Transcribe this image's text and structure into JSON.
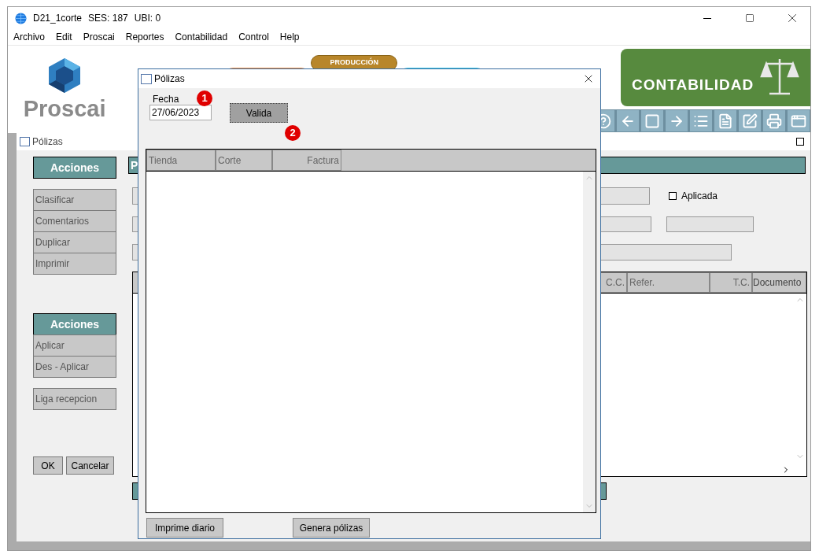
{
  "window": {
    "title": "D21_1corte",
    "session": "SES: 187",
    "location": "UBI: 0"
  },
  "menu": [
    "Archivo",
    "Edit",
    "Proscai",
    "Reportes",
    "Contabilidad",
    "Control",
    "Help"
  ],
  "banner": {
    "brand": "Proscai",
    "module_tab": "PRODUCCIÓN",
    "module": "CONTABILIDAD"
  },
  "child_window": {
    "title": "Pólizas"
  },
  "actions": [
    {
      "title": "Acciones",
      "items": [
        "Clasificar",
        "Comentarios",
        "Duplicar",
        "Imprimir"
      ]
    },
    {
      "title": "Acciones",
      "items": [
        "Aplicar",
        "Des - Aplicar"
      ]
    },
    {
      "items": [
        "Liga recepcion"
      ]
    }
  ],
  "form": {
    "header": "P",
    "applied": {
      "label": "Aplicada",
      "checked": false
    },
    "columns": [
      "C.C.",
      "Refer.",
      "T.C.",
      "Documento"
    ]
  },
  "buttons": [
    "OK",
    "Cancelar"
  ],
  "dialog": {
    "title": "Pólizas",
    "date_label": "Fecha",
    "date_value": "27/06/2023",
    "validate": "Valida",
    "markers": [
      "1",
      "2"
    ],
    "columns": [
      "Tienda",
      "Corte",
      "Factura"
    ],
    "buttons": [
      "Imprime diario",
      "Genera pólizas"
    ]
  }
}
